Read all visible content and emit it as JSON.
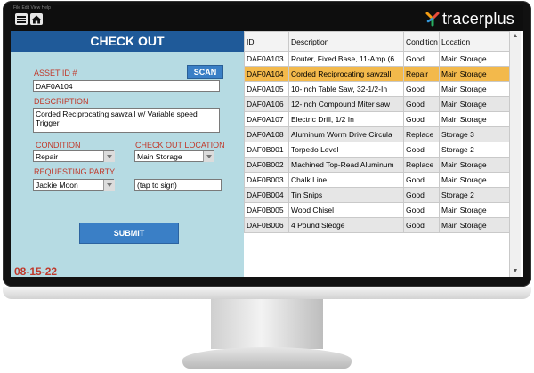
{
  "app": {
    "menu_tiny": "File  Edit  View  Help",
    "logo_text": "tracerplus"
  },
  "form": {
    "title": "CHECK OUT",
    "asset_id_label": "ASSET ID #",
    "scan_label": "SCAN",
    "asset_id_value": "DAF0A104",
    "description_label": "DESCRIPTION",
    "description_value": "Corded Reciprocating sawzall w/ Variable speed Trigger",
    "condition_label": "CONDITION",
    "condition_value": "Repair",
    "checkout_location_label": "CHECK OUT LOCATION",
    "checkout_location_value": "Main Storage",
    "requesting_party_label": "REQUESTING PARTY",
    "requesting_party_value": "Jackie Moon",
    "signature_placeholder": "(tap to sign)",
    "submit_label": "SUBMIT",
    "date": "08-15-22"
  },
  "table": {
    "columns": [
      "ID",
      "Description",
      "Condition",
      "Location"
    ],
    "rows": [
      {
        "id": "DAF0A103",
        "description": "Router, Fixed Base, 11-Amp (6",
        "condition": "Good",
        "location": "Main Storage"
      },
      {
        "id": "DAF0A104",
        "description": "Corded Reciprocating sawzall",
        "condition": "Repair",
        "location": "Main Storage"
      },
      {
        "id": "DAF0A105",
        "description": "10-Inch Table Saw, 32-1/2-In",
        "condition": "Good",
        "location": "Main Storage"
      },
      {
        "id": "DAF0A106",
        "description": "12-Inch Compound Miter saw",
        "condition": "Good",
        "location": "Main Storage"
      },
      {
        "id": "DAF0A107",
        "description": "Electric Drill, 1/2 In",
        "condition": "Good",
        "location": "Main Storage"
      },
      {
        "id": "DAF0A108",
        "description": "Aluminum Worm Drive Circula",
        "condition": "Replace",
        "location": "Storage 3"
      },
      {
        "id": "DAF0B001",
        "description": "Torpedo Level",
        "condition": "Good",
        "location": "Storage 2"
      },
      {
        "id": "DAF0B002",
        "description": "Machined Top-Read Aluminum",
        "condition": "Replace",
        "location": "Main Storage"
      },
      {
        "id": "DAF0B003",
        "description": "Chalk Line",
        "condition": "Good",
        "location": "Main Storage"
      },
      {
        "id": "DAF0B004",
        "description": "Tin Snips",
        "condition": "Good",
        "location": "Storage 2"
      },
      {
        "id": "DAF0B005",
        "description": "Wood Chisel",
        "condition": "Good",
        "location": "Main Storage"
      },
      {
        "id": "DAF0B006",
        "description": "4 Pound Sledge",
        "condition": "Good",
        "location": "Main Storage"
      }
    ],
    "selected_row": 1
  },
  "colors": {
    "header_blue": "#1f5a99",
    "button_blue": "#3a7fc6",
    "label_red": "#c0392b",
    "panel_bg": "#b6dbe3",
    "selected_row": "#f3b94b"
  }
}
